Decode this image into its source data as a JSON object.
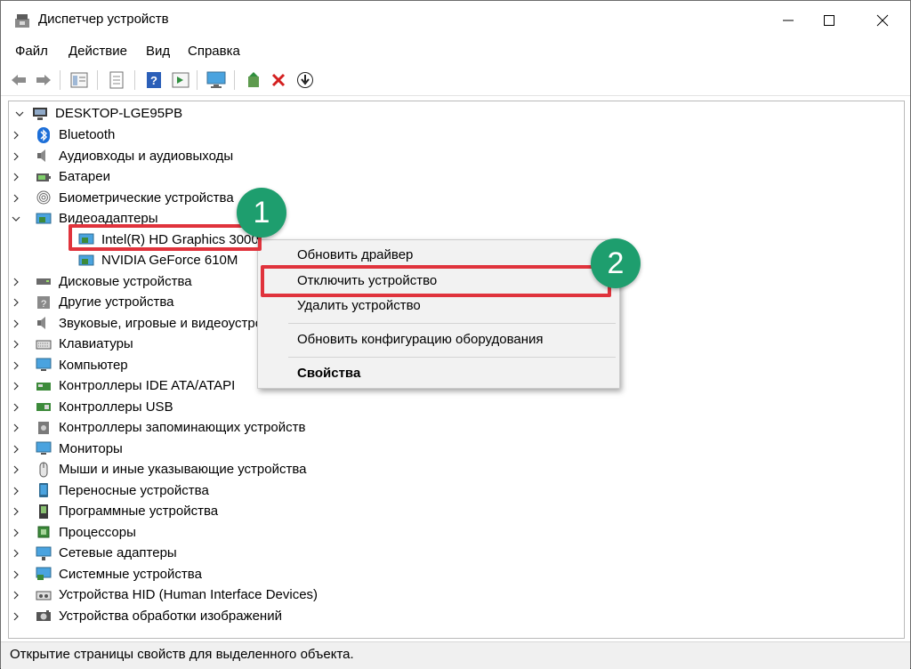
{
  "window": {
    "title": "Диспетчер устройств"
  },
  "menu": [
    "Файл",
    "Действие",
    "Вид",
    "Справка"
  ],
  "toolbar_icons": [
    "back-icon",
    "forward-icon",
    "view-icon",
    "properties-icon",
    "help-icon",
    "action-icon",
    "monitor-icon",
    "update-driver-icon",
    "delete-icon",
    "download-icon"
  ],
  "tree": {
    "root": "DESKTOP-LGE95PB",
    "items": [
      {
        "label": "Bluetooth",
        "icon": "bluetooth-icon"
      },
      {
        "label": "Аудиовходы и аудиовыходы",
        "icon": "speaker-icon"
      },
      {
        "label": "Батареи",
        "icon": "battery-icon"
      },
      {
        "label": "Биометрические устройства",
        "icon": "fingerprint-icon"
      },
      {
        "label": "Видеоадаптеры",
        "icon": "display-adapter-icon",
        "expanded": true
      },
      {
        "label": "Intel(R) HD Graphics 3000",
        "icon": "display-adapter-icon",
        "child": true
      },
      {
        "label": "NVIDIA GeForce 610M",
        "icon": "display-adapter-icon",
        "child": true
      },
      {
        "label": "Дисковые устройства",
        "icon": "disk-icon"
      },
      {
        "label": "Другие устройства",
        "icon": "unknown-device-icon"
      },
      {
        "label": "Звуковые, игровые и видеоустройства",
        "icon": "sound-icon"
      },
      {
        "label": "Клавиатуры",
        "icon": "keyboard-icon"
      },
      {
        "label": "Компьютер",
        "icon": "computer-icon"
      },
      {
        "label": "Контроллеры IDE ATA/ATAPI",
        "icon": "ide-icon"
      },
      {
        "label": "Контроллеры USB",
        "icon": "usb-icon"
      },
      {
        "label": "Контроллеры запоминающих устройств",
        "icon": "storage-icon"
      },
      {
        "label": "Мониторы",
        "icon": "monitor-icon"
      },
      {
        "label": "Мыши и иные указывающие устройства",
        "icon": "mouse-icon"
      },
      {
        "label": "Переносные устройства",
        "icon": "portable-icon"
      },
      {
        "label": "Программные устройства",
        "icon": "software-device-icon"
      },
      {
        "label": "Процессоры",
        "icon": "cpu-icon"
      },
      {
        "label": "Сетевые адаптеры",
        "icon": "network-icon"
      },
      {
        "label": "Системные устройства",
        "icon": "system-icon"
      },
      {
        "label": "Устройства HID (Human Interface Devices)",
        "icon": "hid-icon"
      },
      {
        "label": "Устройства обработки изображений",
        "icon": "camera-icon"
      }
    ]
  },
  "context_menu": {
    "update": "Обновить драйвер",
    "disable": "Отключить устройство",
    "uninstall": "Удалить устройство",
    "scan": "Обновить конфигурацию оборудования",
    "properties": "Свойства"
  },
  "annotations": {
    "step1": "1",
    "step2": "2"
  },
  "status": "Открытие страницы свойств для выделенного объекта.",
  "colors": {
    "highlight": "#e0333c",
    "badge": "#1e9e6e"
  }
}
